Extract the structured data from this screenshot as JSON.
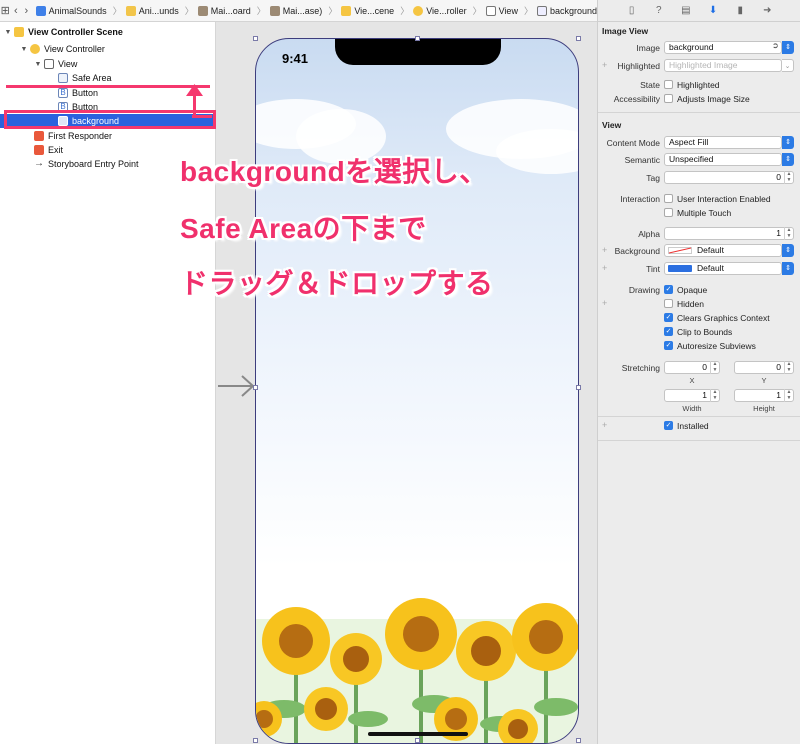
{
  "jumpbar": {
    "crumbs": [
      {
        "label": "AnimalSounds",
        "icon": "project-icon"
      },
      {
        "label": "Ani...unds",
        "icon": "folder-icon"
      },
      {
        "label": "Mai...oard",
        "icon": "storyboard-icon"
      },
      {
        "label": "Mai...ase)",
        "icon": "storyboard-icon"
      },
      {
        "label": "Vie...cene",
        "icon": "scene-icon"
      },
      {
        "label": "Vie...roller",
        "icon": "view-controller-icon"
      },
      {
        "label": "View",
        "icon": "view-icon"
      },
      {
        "label": "background",
        "icon": "image-view-icon"
      }
    ]
  },
  "navigator": {
    "scene": "View Controller Scene",
    "view_controller": "View Controller",
    "view": "View",
    "safe_area": "Safe Area",
    "button1": "Button",
    "button2": "Button",
    "background": "background",
    "first_responder": "First Responder",
    "exit": "Exit",
    "entry_point": "Storyboard Entry Point"
  },
  "canvas": {
    "status_time": "9:41"
  },
  "annotation": {
    "line1": "backgroundを選択し、",
    "line2": "Safe Areaの下まで",
    "line3": "ドラッグ＆ドロップする",
    "color": "#f0306c"
  },
  "inspector": {
    "image_view": {
      "title": "Image View",
      "image_label": "Image",
      "image_value": "background",
      "highlighted_label": "Highlighted",
      "highlighted_placeholder": "Highlighted Image",
      "state_label": "State",
      "state_checkbox": "Highlighted",
      "accessibility_label": "Accessibility",
      "accessibility_checkbox": "Adjusts Image Size"
    },
    "view": {
      "title": "View",
      "content_mode_label": "Content Mode",
      "content_mode_value": "Aspect Fill",
      "semantic_label": "Semantic",
      "semantic_value": "Unspecified",
      "tag_label": "Tag",
      "tag_value": "0",
      "interaction_label": "Interaction",
      "user_interaction": "User Interaction Enabled",
      "multiple_touch": "Multiple Touch",
      "alpha_label": "Alpha",
      "alpha_value": "1",
      "background_label": "Background",
      "background_value": "Default",
      "tint_label": "Tint",
      "tint_value": "Default",
      "drawing_label": "Drawing",
      "opaque": "Opaque",
      "hidden": "Hidden",
      "clears_graphics": "Clears Graphics Context",
      "clip_to_bounds": "Clip to Bounds",
      "autoresize": "Autoresize Subviews",
      "stretching_label": "Stretching",
      "x_value": "0",
      "y_value": "0",
      "x_label": "X",
      "y_label": "Y",
      "width_value": "1",
      "height_value": "1",
      "width_label": "Width",
      "height_label": "Height",
      "installed": "Installed"
    },
    "checked": {
      "highlighted": false,
      "adjusts_image_size": false,
      "user_interaction": false,
      "multiple_touch": false,
      "opaque": true,
      "hidden": false,
      "clears_graphics": true,
      "clip_to_bounds": true,
      "autoresize": true,
      "installed": true
    },
    "tint_color": "#2c6fe0",
    "accent_color": "#2c7be5"
  }
}
